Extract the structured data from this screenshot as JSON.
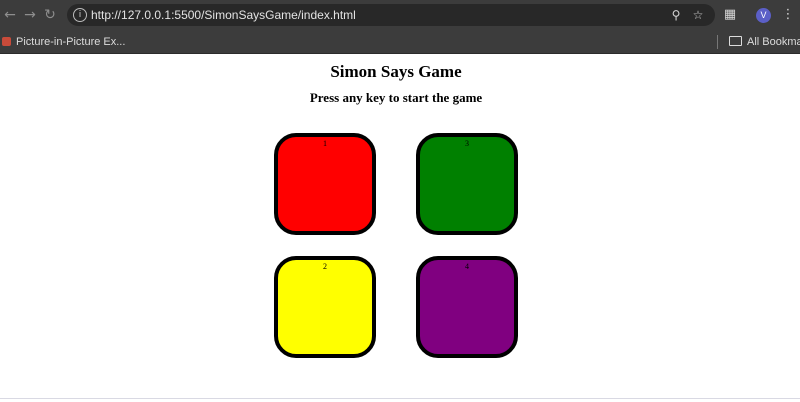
{
  "browser": {
    "url": "http://127.0.0.1:5500/SimonSaysGame/index.html",
    "profile_initial": "V",
    "bookmarks": [
      {
        "label": "Picture-in-Picture Ex..."
      }
    ],
    "all_bookmarks_label": "All Bookmarks",
    "icons": {
      "back": "arrow-left-icon",
      "forward": "arrow-right-icon",
      "reload": "reload-icon",
      "site_info": "info-icon",
      "zoom": "zoom-icon",
      "bookmark_star": "star-icon",
      "extensions": "puzzle-icon",
      "menu": "more-vertical-icon"
    }
  },
  "page": {
    "title": "Simon Says Game",
    "subtitle": "Press any key to start the game",
    "buttons": [
      {
        "id": "1",
        "label": "1",
        "color": "#ff0000"
      },
      {
        "id": "3",
        "label": "3",
        "color": "#008000"
      },
      {
        "id": "2",
        "label": "2",
        "color": "#ffff00"
      },
      {
        "id": "4",
        "label": "4",
        "color": "#800080"
      }
    ]
  }
}
